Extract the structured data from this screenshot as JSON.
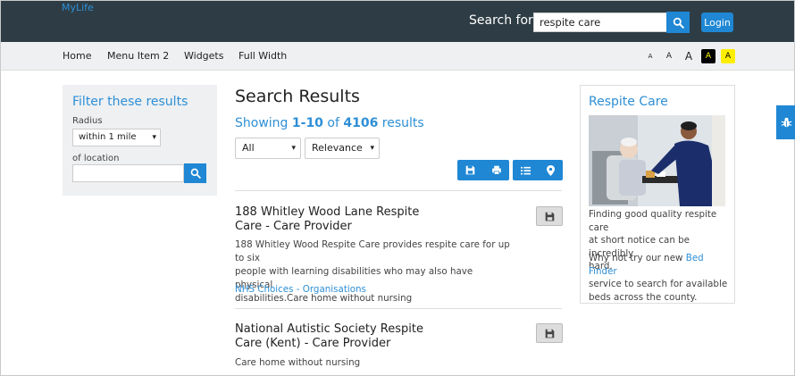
{
  "header": {
    "logo": "MyLife",
    "search_label": "Search for",
    "search_value": "respite care",
    "login_label": "Login"
  },
  "nav": {
    "items": [
      "Home",
      "Menu Item 2",
      "Widgets",
      "Full Width"
    ],
    "font_sizes": [
      "A",
      "A",
      "A",
      "A",
      "A"
    ]
  },
  "filter": {
    "title": "Filter these results",
    "radius_label": "Radius",
    "radius_value": "within 1 mile",
    "location_label": "of location",
    "location_value": ""
  },
  "results": {
    "title": "Search Results",
    "count_prefix": "Showing",
    "count_range": "1-10",
    "count_of": "of",
    "count_total": "4106",
    "count_suffix": "results",
    "filter_select": "All",
    "sort_select": "Relevance",
    "items": [
      {
        "title_line1": "188 Whitley Wood Lane Respite",
        "title_line2": "Care - Care Provider",
        "desc_lines": [
          "188 Whitley Wood Respite Care provides respite care for up to six",
          "people with learning disabilities who may also have physical",
          "disabilities.Care home without nursing"
        ],
        "source": "NHS Choices - Organisations"
      },
      {
        "title_line1": "National Autistic Society Respite",
        "title_line2": "Care (Kent) - Care Provider",
        "desc_lines": [
          "Care home without nursing"
        ]
      }
    ]
  },
  "sidebar": {
    "title": "Respite Care",
    "para1_lines": [
      "Finding good quality respite care",
      "at short notice can be incredibly",
      "hard."
    ],
    "para2_line1_prefix": "Why not try our new",
    "para2_link": "Bed Finder",
    "para2_rest_lines": [
      "service to search for available",
      "beds across the county."
    ]
  },
  "icons": {
    "search": "search-icon",
    "save": "save-icon",
    "print": "print-icon",
    "list": "list-icon",
    "map": "map-marker-icon",
    "bug": "bug-icon"
  },
  "colors": {
    "header_bg": "#2e3d45",
    "accent": "#1f87d4",
    "link": "#2e8fd6"
  }
}
